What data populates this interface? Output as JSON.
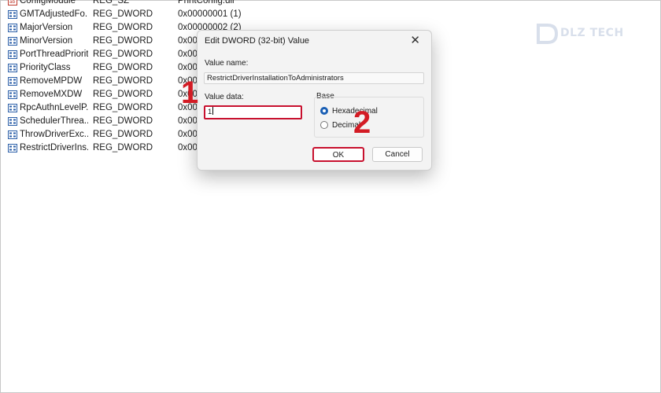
{
  "registry_values": [
    {
      "name": "ConfigModule",
      "type": "REG_SZ",
      "data": "PrintConfig.dll"
    },
    {
      "name": "GMTAdjustedFo...",
      "type": "REG_DWORD",
      "data": "0x00000001 (1)"
    },
    {
      "name": "MajorVersion",
      "type": "REG_DWORD",
      "data": "0x00000002 (2)"
    },
    {
      "name": "MinorVersion",
      "type": "REG_DWORD",
      "data": "0x000"
    },
    {
      "name": "PortThreadPriority",
      "type": "REG_DWORD",
      "data": "0x000"
    },
    {
      "name": "PriorityClass",
      "type": "REG_DWORD",
      "data": "0x000"
    },
    {
      "name": "RemoveMPDW",
      "type": "REG_DWORD",
      "data": "0x000"
    },
    {
      "name": "RemoveMXDW",
      "type": "REG_DWORD",
      "data": "0x000"
    },
    {
      "name": "RpcAuthnLevelP...",
      "type": "REG_DWORD",
      "data": "0x000"
    },
    {
      "name": "SchedulerThrea...",
      "type": "REG_DWORD",
      "data": "0x000"
    },
    {
      "name": "ThrowDriverExc...",
      "type": "REG_DWORD",
      "data": "0x000"
    },
    {
      "name": "RestrictDriverIns...",
      "type": "REG_DWORD",
      "data": "0x000"
    }
  ],
  "watermark": {
    "text": "DLZ TECH"
  },
  "dialog": {
    "title": "Edit DWORD (32-bit) Value",
    "close_glyph": "✕",
    "value_name_label": "Value name:",
    "value_name": "RestrictDriverInstallationToAdministrators",
    "value_data_label": "Value data:",
    "value_data": "1",
    "base_label": "Base",
    "radio_hex": "Hexadecimal",
    "radio_dec": "Decimal",
    "ok_label": "OK",
    "cancel_label": "Cancel"
  },
  "markers": {
    "step1": "1",
    "step2": "2"
  },
  "colors": {
    "highlight": "#c8102e",
    "marker": "#d31b24",
    "radio_selected": "#1a5fb4"
  }
}
